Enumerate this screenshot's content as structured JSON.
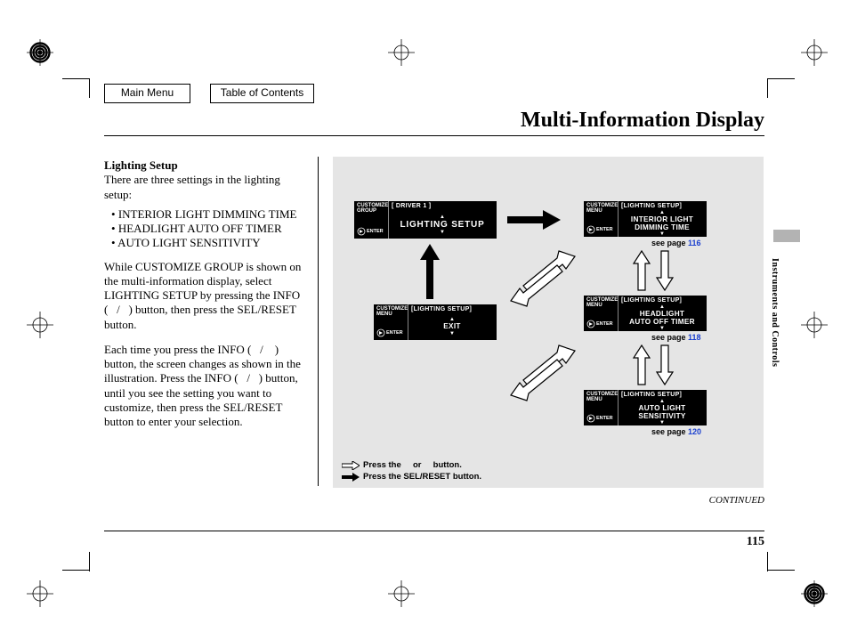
{
  "nav": {
    "main_menu": "Main Menu",
    "toc": "Table of Contents"
  },
  "title": "Multi-Information Display",
  "section_label": "Instruments and Controls",
  "page_number": "115",
  "continued": "CONTINUED",
  "body": {
    "subhead": "Lighting Setup",
    "intro": "There are three settings in the lighting setup:",
    "items": [
      "INTERIOR LIGHT DIMMING TIME",
      "HEADLIGHT AUTO OFF TIMER",
      "AUTO LIGHT SENSITIVITY"
    ],
    "p1": "While CUSTOMIZE GROUP is shown on the multi-information display, select LIGHTING SETUP by pressing the INFO (   /   ) button, then press the SEL/RESET button.",
    "p2": "Each time you press the INFO (   /    ) button, the screen changes as shown in the illustration. Press the INFO (   /   ) button, until you see the setting you want to customize, then press the SEL/RESET button to enter your selection."
  },
  "figure": {
    "screens": {
      "group": {
        "side_l1": "CUSTOMIZE",
        "side_l2": "GROUP",
        "enter": "ENTER",
        "hdr": "[ DRIVER 1 ]",
        "main": "LIGHTING SETUP"
      },
      "exit": {
        "side_l1": "CUSTOMIZE",
        "side_l2": "MENU",
        "enter": "ENTER",
        "hdr": "[LIGHTING SETUP]",
        "main": "EXIT"
      },
      "interior": {
        "side_l1": "CUSTOMIZE",
        "side_l2": "MENU",
        "enter": "ENTER",
        "hdr": "[LIGHTING SETUP]",
        "main_l1": "INTERIOR LIGHT",
        "main_l2": "DIMMING TIME"
      },
      "headlight": {
        "side_l1": "CUSTOMIZE",
        "side_l2": "MENU",
        "enter": "ENTER",
        "hdr": "[LIGHTING SETUP]",
        "main_l1": "HEADLIGHT",
        "main_l2": "AUTO OFF TIMER"
      },
      "autolight": {
        "side_l1": "CUSTOMIZE",
        "side_l2": "MENU",
        "enter": "ENTER",
        "hdr": "[LIGHTING SETUP]",
        "main_l1": "AUTO LIGHT",
        "main_l2": "SENSITIVITY"
      }
    },
    "see_prefix": "see page ",
    "see116": "116",
    "see118": "118",
    "see120": "120",
    "legend_l1a": "Press the ",
    "legend_l1b": " or ",
    "legend_l1c": " button.",
    "legend_l2": "Press the SEL/RESET button."
  }
}
